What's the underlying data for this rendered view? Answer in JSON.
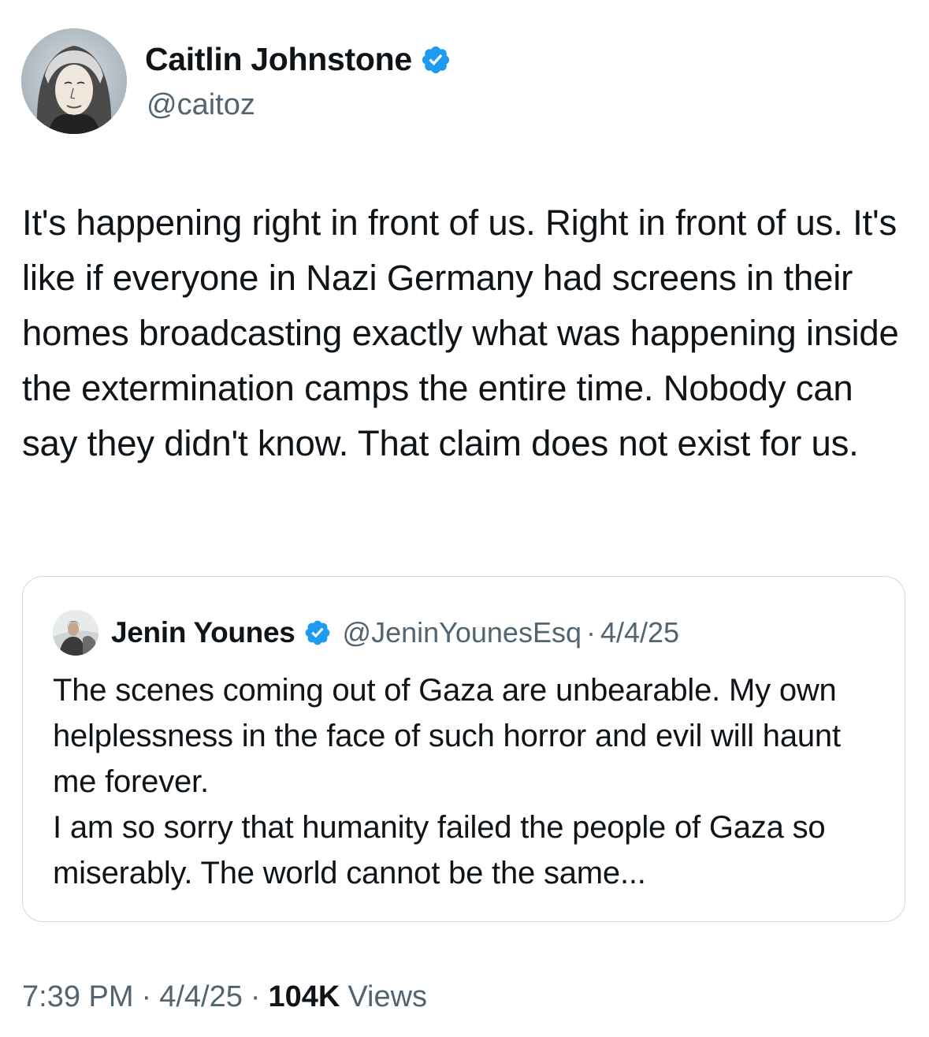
{
  "tweet": {
    "author": {
      "name": "Caitlin Johnstone",
      "handle": "@caitoz",
      "verified": true
    },
    "text": "It's happening right in front of us. Right in front of us. It's like if everyone in Nazi Germany had screens in their homes broadcasting exactly what was happening inside the extermination camps the entire time. Nobody can say they didn't know. That claim does not exist for us.",
    "quoted": {
      "name": "Jenin Younes",
      "handle": "@JeninYounesEsq",
      "separator": "·",
      "date": "4/4/25",
      "verified": true,
      "text": "The scenes coming out of Gaza are unbearable.  My own helplessness in the face of such horror and evil will haunt me forever.\nI am so sorry that humanity failed the people of Gaza so miserably. The world cannot be the same..."
    },
    "meta": {
      "time": "7:39 PM",
      "separator": "·",
      "date": "4/4/25",
      "views_count": "104K",
      "views_label": "Views"
    }
  },
  "colors": {
    "text_primary": "#0f1419",
    "text_secondary": "#536471",
    "verified_blue": "#1d9bf0",
    "border": "#cfd9de"
  },
  "icons": {
    "verified": "verified-badge-icon"
  }
}
